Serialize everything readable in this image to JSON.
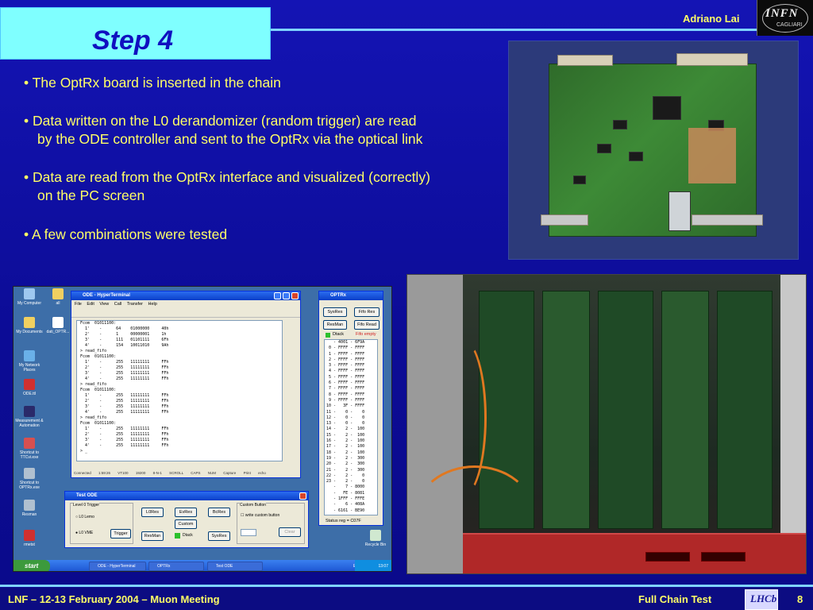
{
  "header": {
    "title": "Step 4",
    "author": "Adriano Lai",
    "logo_name": "INFN",
    "logo_sub": "CAGLIARI"
  },
  "bullets": [
    {
      "line1": "• The OptRx board is inserted in the chain",
      "line2": ""
    },
    {
      "line1": "• Data written on the L0 derandomizer (random trigger) are read",
      "line2": "by the ODE controller and sent to the OptRx via the optical link"
    },
    {
      "line1": "• Data are read from the OptRx interface and visualized (correctly)",
      "line2": "on the PC screen"
    },
    {
      "line1": "• A few combinations were tested",
      "line2": ""
    }
  ],
  "screenshot": {
    "desktop_icons": [
      "My Computer",
      "all",
      "My Documents",
      "dati_OPTR...",
      "My Network Places",
      "ODE.ttl",
      "Measurement & Automation",
      "Shortcut to TTCvi.exe",
      "Shortcut to OPTRx.exe",
      "Resman",
      "rmetst",
      "Recycle Bin"
    ],
    "hyperterminal": {
      "title": "ODE - HyperTerminal",
      "menu": [
        "File",
        "Edit",
        "View",
        "Call",
        "Transfer",
        "Help"
      ],
      "lines": [
        "Fcom  01011100:",
        "  1'    -      64    01000000     40h",
        "  2'    -      1     00000001     1h",
        "  3'    -      111   01101111     6Fh",
        "  4'    -      154   10011010     9Ah",
        "> read_fifo",
        "Fcom  01011100:",
        "  1'    -      255   11111111     FFh",
        "  2'    -      255   11111111     FFh",
        "  3'    -      255   11111111     FFh",
        "  4'    -      255   11111111     FFh",
        "> read_fifo",
        "Fcom  01011100:",
        "  1'    -      255   11111111     FFh",
        "  2'    -      255   11111111     FFh",
        "  3'    -      255   11111111     FFh",
        "  4'    -      255   11111111     FFh",
        "> read_fifo",
        "Fcom  01011100:",
        "  1'    -      255   11111111     FFh",
        "  2'    -      255   11111111     FFh",
        "  3'    -      255   11111111     FFh",
        "  4'    -      255   11111111     FFh",
        "> _"
      ],
      "status": [
        "Connected 1:59:26",
        "VT100",
        "19200 8-N-1",
        "SCROLL",
        "CAPS",
        "NUM",
        "Capture",
        "Print echo"
      ]
    },
    "optrx": {
      "title": "OPTRx",
      "buttons": [
        "SysRes",
        "Fifo Res",
        "ResMan",
        "Fifo Read"
      ],
      "dtack": "Dtack",
      "fifo_status": "Fifo empty",
      "lines": [
        "   - 4001 - 6F9A",
        " 0 - FFFF - FFFF",
        " 1 - FFFF - FFFF",
        " 2 - FFFF - FFFF",
        " 3 - FFFF - FFFF",
        " 4 - FFFF - FFFF",
        " 5 - FFFF - FFFF",
        " 6 - FFFF - FFFF",
        " 7 - FFFF - FFFF",
        " 8 - FFFF - FFFF",
        " 9 - FFFF - FFFF",
        "10 -   3F - FFFF",
        "11 -    0 -    0",
        "12 -    0 -    0",
        "13 -    0 -    0",
        "14 -    2 -  100",
        "15 -    2 -  100",
        "16 -    2 -  100",
        "17 -    2 -  100",
        "18 -    2 -  100",
        "19 -    2 -  300",
        "20 -    2 -  300",
        "21 -    2 -  300",
        "22 -    2 -    0",
        "23 -    2 -    0",
        "   -    7 - 8000",
        "   -   FE - 8081",
        "   - 1FFF - FFFE",
        "   -    6 - 408A",
        "   - 6161 - BE90"
      ],
      "status_reg": "Status reg = C07F"
    },
    "test_ode": {
      "title": "Test ODE",
      "group_trigger": "Level 0 Trigger",
      "radio1": "L0 Lemo",
      "radio2": "L0 VME",
      "trigger_btn": "Trigger",
      "buttons_row1": [
        "L0Res",
        "EvRes",
        "BcRes"
      ],
      "custom_btn": "Custom",
      "buttons_row3": [
        "ResMan",
        "SysRes"
      ],
      "dtack": "Dtack",
      "group_custom": "Custom Button",
      "checkbox": "write custom button",
      "clear_btn": "Clear"
    },
    "taskbar": {
      "start": "start",
      "tasks": [
        "ODE - HyperTerminal",
        "OPTRx",
        "Test ODE"
      ],
      "lang": "EN",
      "clock": "13:07"
    }
  },
  "footer": {
    "left": "LNF – 12-13 February 2004 – Muon Meeting",
    "center": "Full Chain Test",
    "logo": "LHCb",
    "page": "8"
  },
  "colors": {
    "background": "#1010a8",
    "title_box": "#7fffff",
    "text": "#ffff66",
    "accent_line": "#7fd4ff"
  }
}
